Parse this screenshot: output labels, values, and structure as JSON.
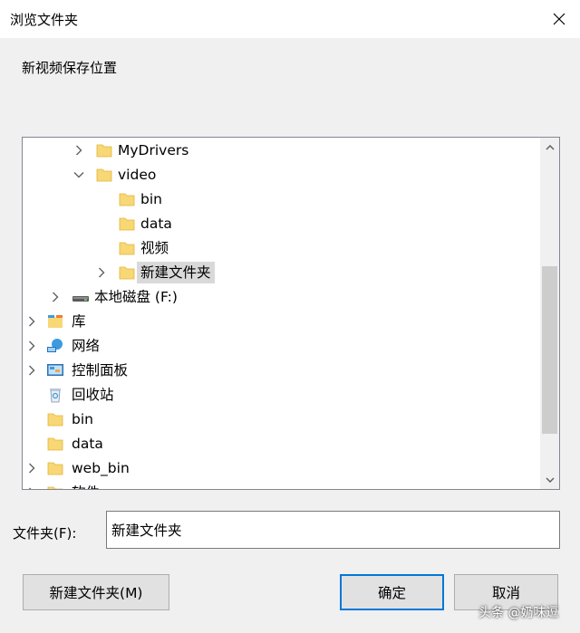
{
  "window": {
    "title": "浏览文件夹"
  },
  "prompt": "新视频保存位置",
  "tree": {
    "items": [
      {
        "label": "MyDrivers",
        "icon": "folder-icon",
        "chevron": "right"
      },
      {
        "label": "video",
        "icon": "folder-icon",
        "chevron": "down"
      },
      {
        "label": "bin",
        "icon": "folder-icon",
        "chevron": ""
      },
      {
        "label": "data",
        "icon": "folder-icon",
        "chevron": ""
      },
      {
        "label": "视频",
        "icon": "folder-icon",
        "chevron": ""
      },
      {
        "label": "新建文件夹",
        "icon": "folder-icon",
        "chevron": "right",
        "selected": true
      },
      {
        "label": "本地磁盘 (F:)",
        "icon": "drive-icon",
        "chevron": "right"
      },
      {
        "label": "库",
        "icon": "library-icon",
        "chevron": "right"
      },
      {
        "label": "网络",
        "icon": "network-icon",
        "chevron": "right"
      },
      {
        "label": "控制面板",
        "icon": "control-panel-icon",
        "chevron": "right"
      },
      {
        "label": "回收站",
        "icon": "recycle-bin-icon",
        "chevron": ""
      },
      {
        "label": "bin",
        "icon": "folder-icon",
        "chevron": ""
      },
      {
        "label": "data",
        "icon": "folder-icon",
        "chevron": ""
      },
      {
        "label": "web_bin",
        "icon": "folder-icon",
        "chevron": "right"
      },
      {
        "label": "软件",
        "icon": "folder-icon",
        "chevron": "right"
      }
    ]
  },
  "folder_field": {
    "label": "文件夹(F):",
    "value": "新建文件夹"
  },
  "buttons": {
    "new_folder": "新建文件夹(M)",
    "ok": "确定",
    "cancel": "取消"
  },
  "watermark": "头条 @奶味逗",
  "colors": {
    "accent": "#0078d7",
    "folder": "#f8d775",
    "selection": "#d9d9d9"
  }
}
